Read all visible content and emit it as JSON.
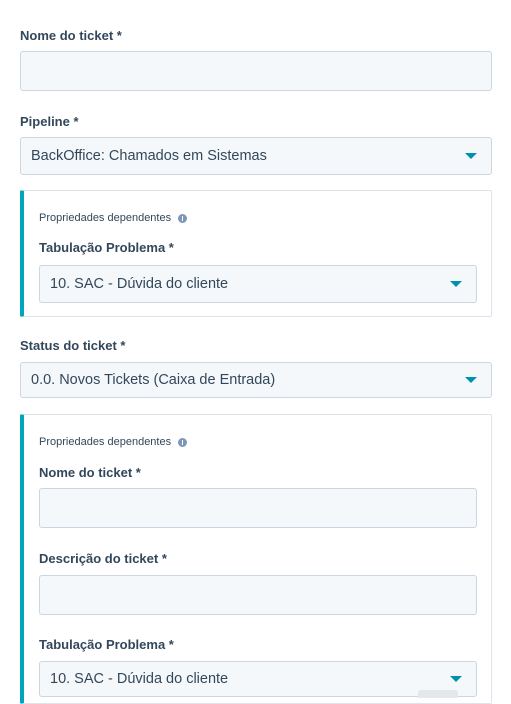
{
  "ticket_name": {
    "label": "Nome do ticket *",
    "value": ""
  },
  "pipeline": {
    "label": "Pipeline *",
    "selected": "BackOffice: Chamados em Sistemas",
    "dependent": {
      "title": "Propriedades dependentes",
      "tabulacao_label": "Tabulação Problema *",
      "tabulacao_selected": "10. SAC - Dúvida do cliente"
    }
  },
  "status": {
    "label": "Status do ticket *",
    "selected": "0.0. Novos Tickets (Caixa de Entrada)",
    "dependent": {
      "title": "Propriedades dependentes",
      "name_label": "Nome do ticket *",
      "name_value": "",
      "description_label": "Descrição do ticket *",
      "description_value": "",
      "tabulacao_label": "Tabulação Problema *",
      "tabulacao_selected": "10. SAC - Dúvida do cliente"
    }
  },
  "colors": {
    "accent": "#00a4bd",
    "caret": "#0091ae",
    "field_bg": "#f5f8fa",
    "border": "#cbd6e2"
  },
  "icons": {
    "dropdown": "caret-down-icon",
    "info": "info-icon"
  }
}
